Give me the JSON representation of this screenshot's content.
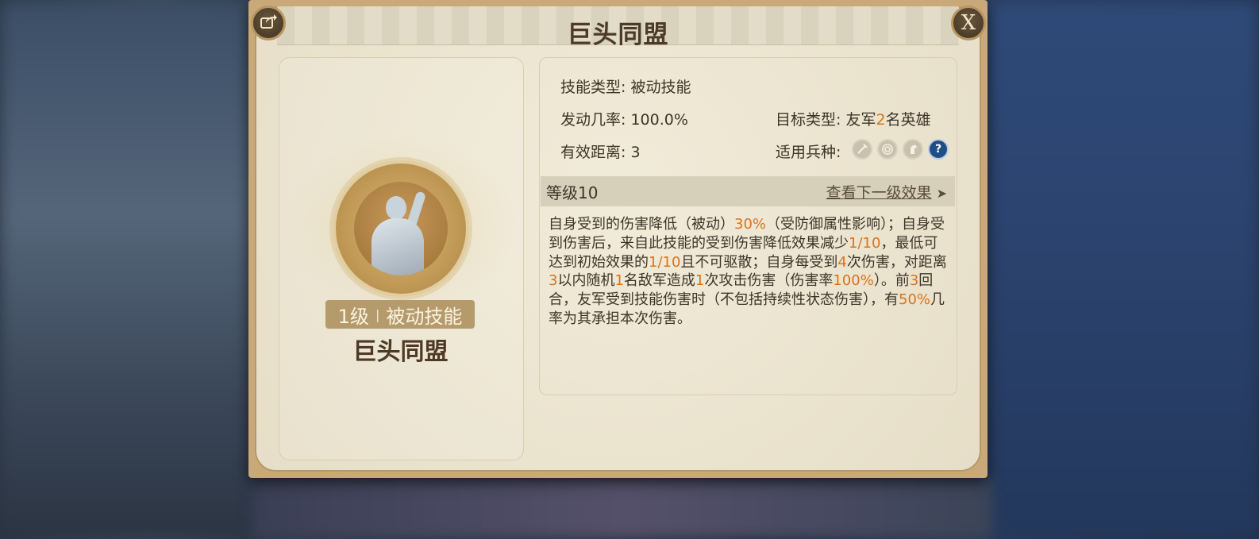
{
  "dialog": {
    "title": "巨头同盟",
    "share_icon": "share-icon",
    "close_label": "X"
  },
  "skill_card": {
    "level": "1级",
    "separator": "|",
    "type": "被动技能",
    "name": "巨头同盟"
  },
  "details": {
    "skill_type_label": "技能类型:",
    "skill_type_value": "被动技能",
    "trigger_rate_label": "发动几率:",
    "trigger_rate_value": "100.0%",
    "target_type_label": "目标类型:",
    "target_type_value_pre": "友军",
    "target_type_value_num": "2",
    "target_type_value_post": "名英雄",
    "range_label": "有效距离:",
    "range_value": "3",
    "troop_label": "适用兵种:",
    "troop_icons": [
      "infantry-sword-icon",
      "archer-target-icon",
      "cavalry-horse-icon",
      "unknown-question-icon"
    ],
    "troop_question_glyph": "?"
  },
  "level_bar": {
    "level": "等级10",
    "next_level_link": "查看下一级效果",
    "arrow": "➤"
  },
  "description": [
    {
      "t": "自身受到的伤害降低（被动）",
      "hl": false
    },
    {
      "t": "30%",
      "hl": true
    },
    {
      "t": "（受防御属性影响）；自身受到伤害后，来自此技能的受到伤害降低效果减少",
      "hl": false
    },
    {
      "t": "1/10",
      "hl": true
    },
    {
      "t": "，最低可达到初始效果的",
      "hl": false
    },
    {
      "t": "1/10",
      "hl": true
    },
    {
      "t": "且不可驱散；自身每受到",
      "hl": false
    },
    {
      "t": "4",
      "hl": true
    },
    {
      "t": "次伤害，对距离",
      "hl": false
    },
    {
      "t": "3",
      "hl": true
    },
    {
      "t": "以内随机",
      "hl": false
    },
    {
      "t": "1",
      "hl": true
    },
    {
      "t": "名敌军造成",
      "hl": false
    },
    {
      "t": "1",
      "hl": true
    },
    {
      "t": "次攻击伤害（伤害率",
      "hl": false
    },
    {
      "t": "100%",
      "hl": true
    },
    {
      "t": "）。前",
      "hl": false
    },
    {
      "t": "3",
      "hl": true
    },
    {
      "t": "回合，友军受到技能伤害时（不包括持续性状态伤害），有",
      "hl": false
    },
    {
      "t": "50%",
      "hl": true
    },
    {
      "t": "几率为其承担本次伤害。",
      "hl": false
    }
  ]
}
